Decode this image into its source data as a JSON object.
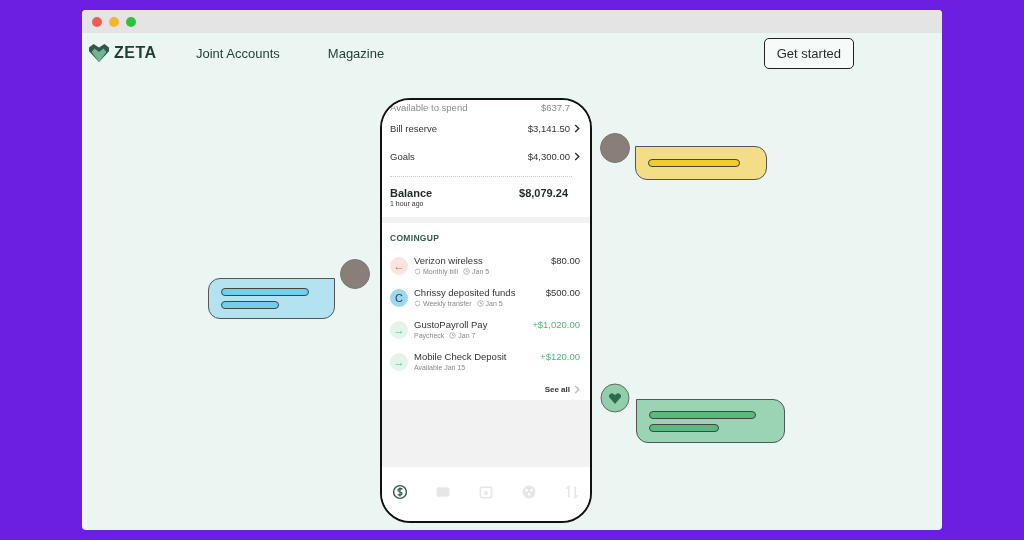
{
  "nav": {
    "brand": "ZETA",
    "links": [
      "Joint Accounts",
      "Magazine"
    ],
    "cta": "Get started"
  },
  "accounts": [
    {
      "label": "Available to spend",
      "amount": "$637.7",
      "chevron": false
    },
    {
      "label": "Bill reserve",
      "amount": "$3,141.50",
      "chevron": true
    },
    {
      "label": "Goals",
      "amount": "$4,300.00",
      "chevron": true
    }
  ],
  "balance": {
    "label": "Balance",
    "amount": "$8,079.24",
    "updated": "1 hour ago"
  },
  "upcoming": {
    "title": "COMINGUP",
    "items": [
      {
        "kind": "outgoing",
        "icon": "←",
        "name": "Verizon wireless",
        "amount": "$80.00",
        "meta": "Monthly bill",
        "date": "Jan 5",
        "recurring": true
      },
      {
        "kind": "person",
        "initial": "C",
        "name": "Chrissy deposited funds",
        "amount": "$500.00",
        "meta": "Weekly transfer",
        "date": "Jan 5",
        "recurring": true
      },
      {
        "kind": "incoming",
        "icon": "→",
        "name": "GustoPayroll Pay",
        "amount": "+$1,020.00",
        "meta": "Paycheck",
        "date": "Jan 7",
        "recurring": false
      },
      {
        "kind": "incoming",
        "icon": "→",
        "name": "Mobile Check Deposit",
        "amount": "+$120.00",
        "meta": "Available Jan 15",
        "recurring": false
      }
    ],
    "see_all": "See all"
  },
  "tabbar": [
    {
      "kind": "dollar",
      "selected": true
    },
    {
      "kind": "card",
      "selected": false
    },
    {
      "kind": "calendar",
      "selected": false
    },
    {
      "kind": "goal",
      "selected": false
    },
    {
      "kind": "transfer",
      "selected": false
    }
  ],
  "bubbles": [
    {
      "kind": "person-short",
      "color": "#f3dd86"
    },
    {
      "kind": "person-long",
      "color": "#b3e3f0"
    },
    {
      "kind": "app-long",
      "color": "#9bd4b4"
    }
  ]
}
